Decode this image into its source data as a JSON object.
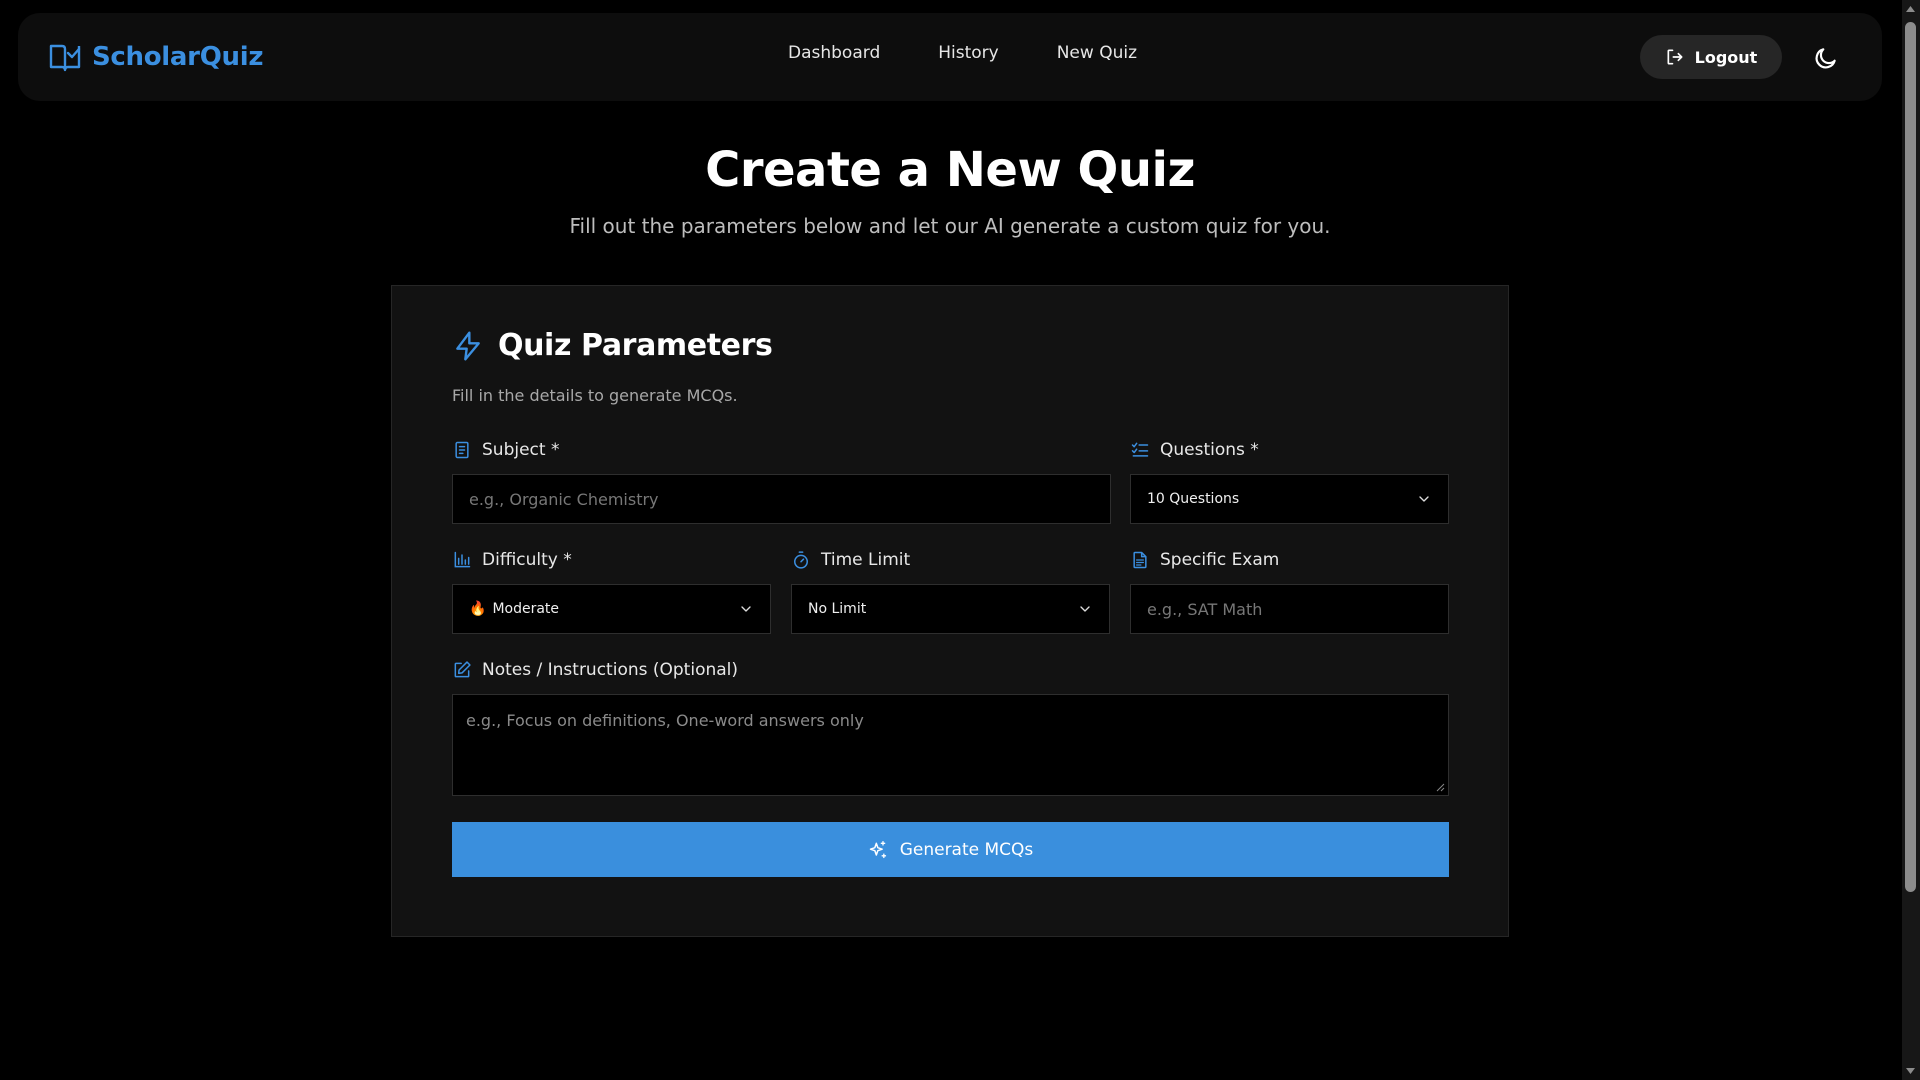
{
  "nav": {
    "brand": "ScholarQuiz",
    "links": [
      "Dashboard",
      "History",
      "New Quiz"
    ],
    "logout_label": "Logout"
  },
  "header": {
    "title": "Create a New Quiz",
    "subtitle": "Fill out the parameters below and let our AI generate a custom quiz for you."
  },
  "card": {
    "title": "Quiz Parameters",
    "description": "Fill in the details to generate MCQs.",
    "subject": {
      "label": "Subject *",
      "placeholder": "e.g., Organic Chemistry"
    },
    "questions": {
      "label": "Questions *",
      "value": "10 Questions"
    },
    "difficulty": {
      "label": "Difficulty *",
      "value": "Moderate",
      "emoji": "🔥"
    },
    "time_limit": {
      "label": "Time Limit",
      "value": "No Limit"
    },
    "exam": {
      "label": "Specific Exam",
      "placeholder": "e.g., SAT Math"
    },
    "notes": {
      "label": "Notes / Instructions (Optional)",
      "placeholder": "e.g., Focus on definitions, One-word answers only"
    },
    "generate_label": "Generate MCQs"
  },
  "colors": {
    "accent": "#3b8fe0",
    "background": "#000000",
    "card": "#121212"
  },
  "icons": [
    "book-check-icon",
    "log-out-icon",
    "moon-icon",
    "zap-icon",
    "notebook-icon",
    "list-checks-icon",
    "bar-chart-icon",
    "timer-icon",
    "file-text-icon",
    "edit-icon",
    "sparkles-icon",
    "chevron-down-icon"
  ]
}
